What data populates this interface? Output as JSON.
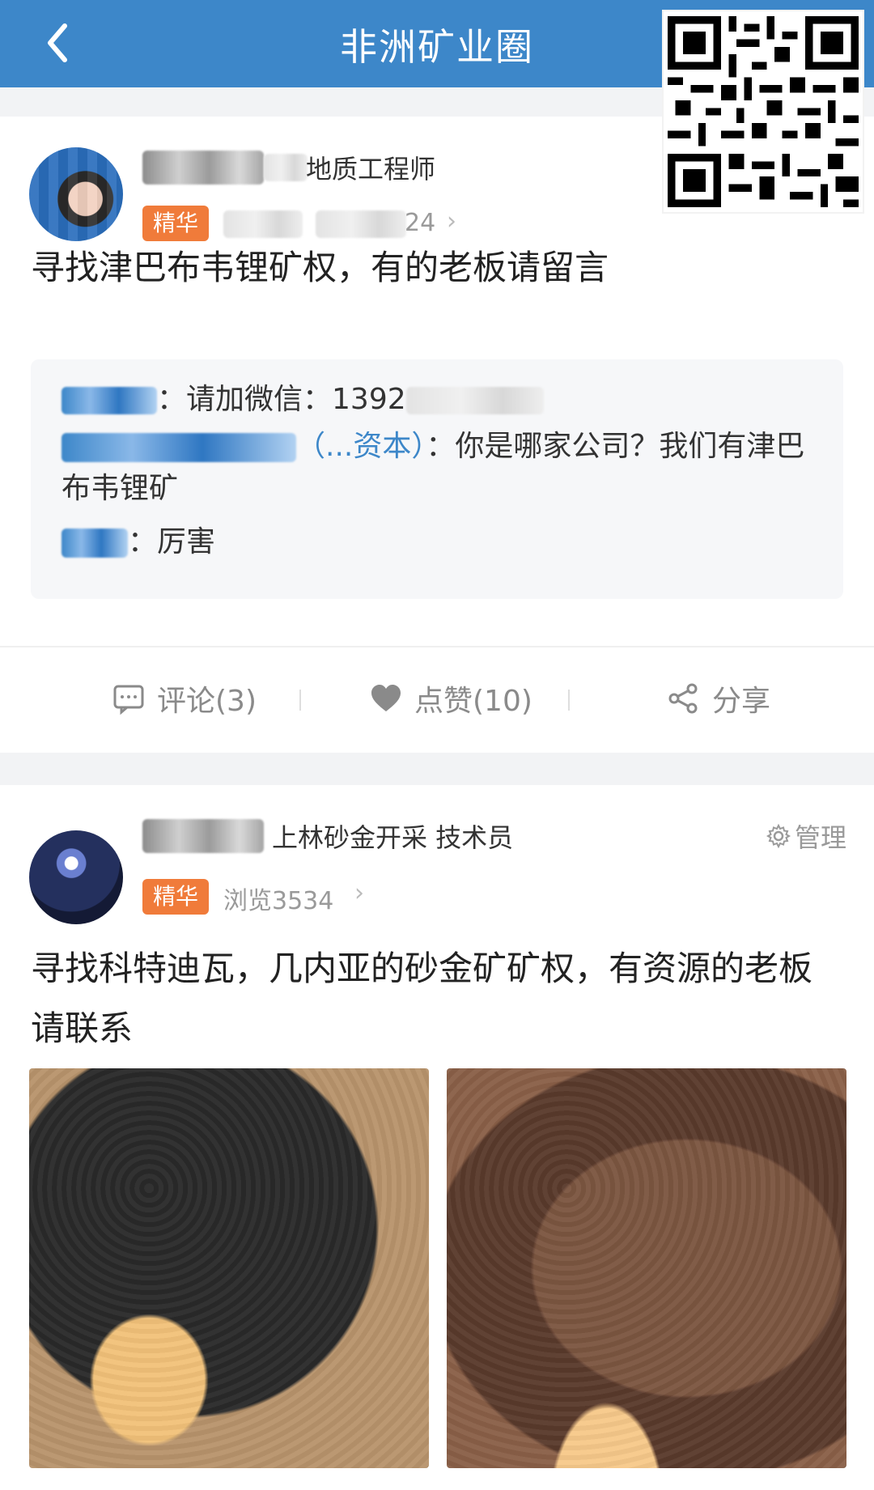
{
  "header": {
    "title": "非洲矿业圈",
    "back_icon": "chevron-left-icon",
    "qr_icon": "qr-code-icon"
  },
  "post1": {
    "author_role": "地质工程师",
    "tag": "精华",
    "meta_suffix": "24",
    "text": "寻找津巴布韦锂矿权，有的老板请留言",
    "comments": [
      {
        "name": "",
        "sep": "：",
        "text": "请加微信：1392"
      },
      {
        "name": "（...资本）",
        "sep": "：",
        "text": "你是哪家公司？我们有津巴布韦锂矿"
      },
      {
        "name": "",
        "sep": "：",
        "text": "厉害"
      }
    ],
    "actions": {
      "comment": "评论(3)",
      "like": "点赞(10)",
      "share": "分享"
    }
  },
  "post2": {
    "author_role": "上林砂金开采 技术员",
    "tag": "精华",
    "views": "浏览3534",
    "manage": "管理",
    "text": "寻找科特迪瓦，几内亚的砂金矿矿权，有资源的老板请联系"
  },
  "colors": {
    "brand_blue": "#3d87c9",
    "tag_orange": "#f07b3a"
  }
}
